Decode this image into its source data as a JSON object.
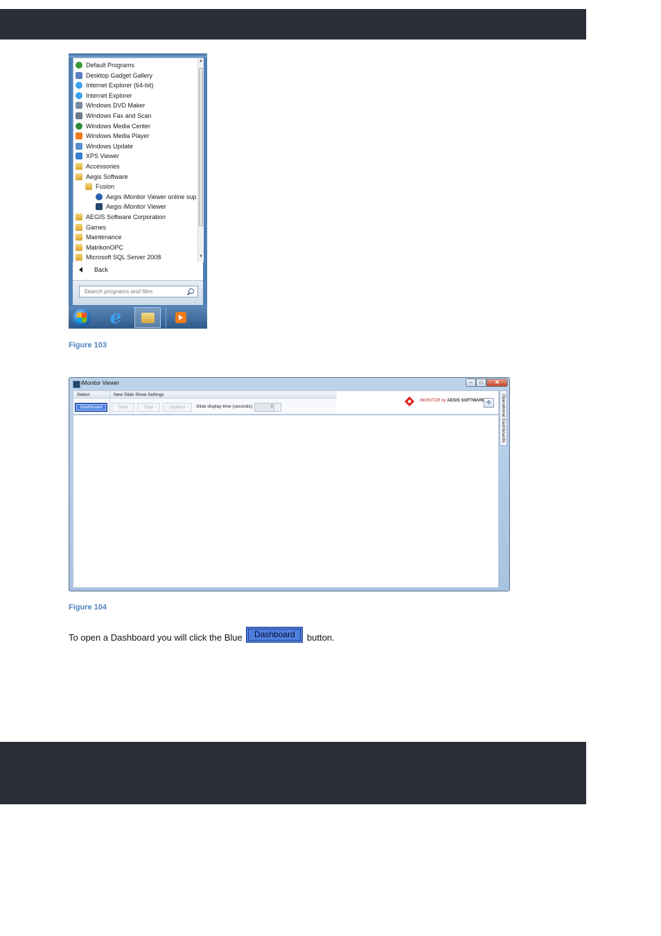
{
  "start_menu": {
    "items": [
      {
        "label": "Default Programs",
        "icon": "default-programs-icon",
        "indent": 0
      },
      {
        "label": "Desktop Gadget Gallery",
        "icon": "gadget-gallery-icon",
        "indent": 0
      },
      {
        "label": "Internet Explorer (64-bit)",
        "icon": "ie-icon",
        "indent": 0
      },
      {
        "label": "Internet Explorer",
        "icon": "ie-icon",
        "indent": 0
      },
      {
        "label": "Windows DVD Maker",
        "icon": "dvd-maker-icon",
        "indent": 0
      },
      {
        "label": "Windows Fax and Scan",
        "icon": "fax-scan-icon",
        "indent": 0
      },
      {
        "label": "Windows Media Center",
        "icon": "media-center-icon",
        "indent": 0
      },
      {
        "label": "Windows Media Player",
        "icon": "media-player-icon",
        "indent": 0
      },
      {
        "label": "Windows Update",
        "icon": "windows-update-icon",
        "indent": 0
      },
      {
        "label": "XPS Viewer",
        "icon": "xps-viewer-icon",
        "indent": 0
      },
      {
        "label": "Accessories",
        "icon": "folder-icon",
        "indent": 0
      },
      {
        "label": "Aegis Software",
        "icon": "folder-icon",
        "indent": 0
      },
      {
        "label": "Fusion",
        "icon": "folder-icon",
        "indent": 1
      },
      {
        "label": "Aegis iMonitor Viewer online sup",
        "icon": "help-icon",
        "indent": 2
      },
      {
        "label": "Aegis iMonitor Viewer",
        "icon": "imonitor-app-icon",
        "indent": 2
      },
      {
        "label": "AEGIS Software Corporation",
        "icon": "folder-icon",
        "indent": 0
      },
      {
        "label": "Games",
        "icon": "folder-icon",
        "indent": 0
      },
      {
        "label": "Maintenance",
        "icon": "folder-icon",
        "indent": 0
      },
      {
        "label": "MatrikonOPC",
        "icon": "folder-icon",
        "indent": 0
      },
      {
        "label": "Microsoft SQL Server 2008",
        "icon": "folder-icon",
        "indent": 0
      }
    ],
    "back_label": "Back",
    "search_placeholder": "Search programs and files",
    "colors": {
      "frame": "#4f7fb3",
      "list_bg": "#ffffff"
    }
  },
  "captions": {
    "figure_103": "Figure 103",
    "figure_104": "Figure 104"
  },
  "imonitor": {
    "title": "iMonitor Viewer",
    "select_group_label": "Select",
    "slideshow_group_label": "New Slide Show Settings",
    "dashboard_button": "Dashboard",
    "start_button": "Start",
    "stop_button": "Stop",
    "options_button": "Options",
    "slide_time_label": "Slide display time (seconds):",
    "slide_time_value": "0",
    "brand_prefix": "iMONITOR by ",
    "brand_company": "AEGIS SOFTWARE",
    "side_tab_label": "Operational Dashboards",
    "colors": {
      "dashboard_button": "#4d7fe0",
      "brand_red": "#e02020"
    }
  },
  "instruction": {
    "before": "To open a Dashboard you will click the Blue",
    "button_label": "Dashboard",
    "after": "button."
  }
}
